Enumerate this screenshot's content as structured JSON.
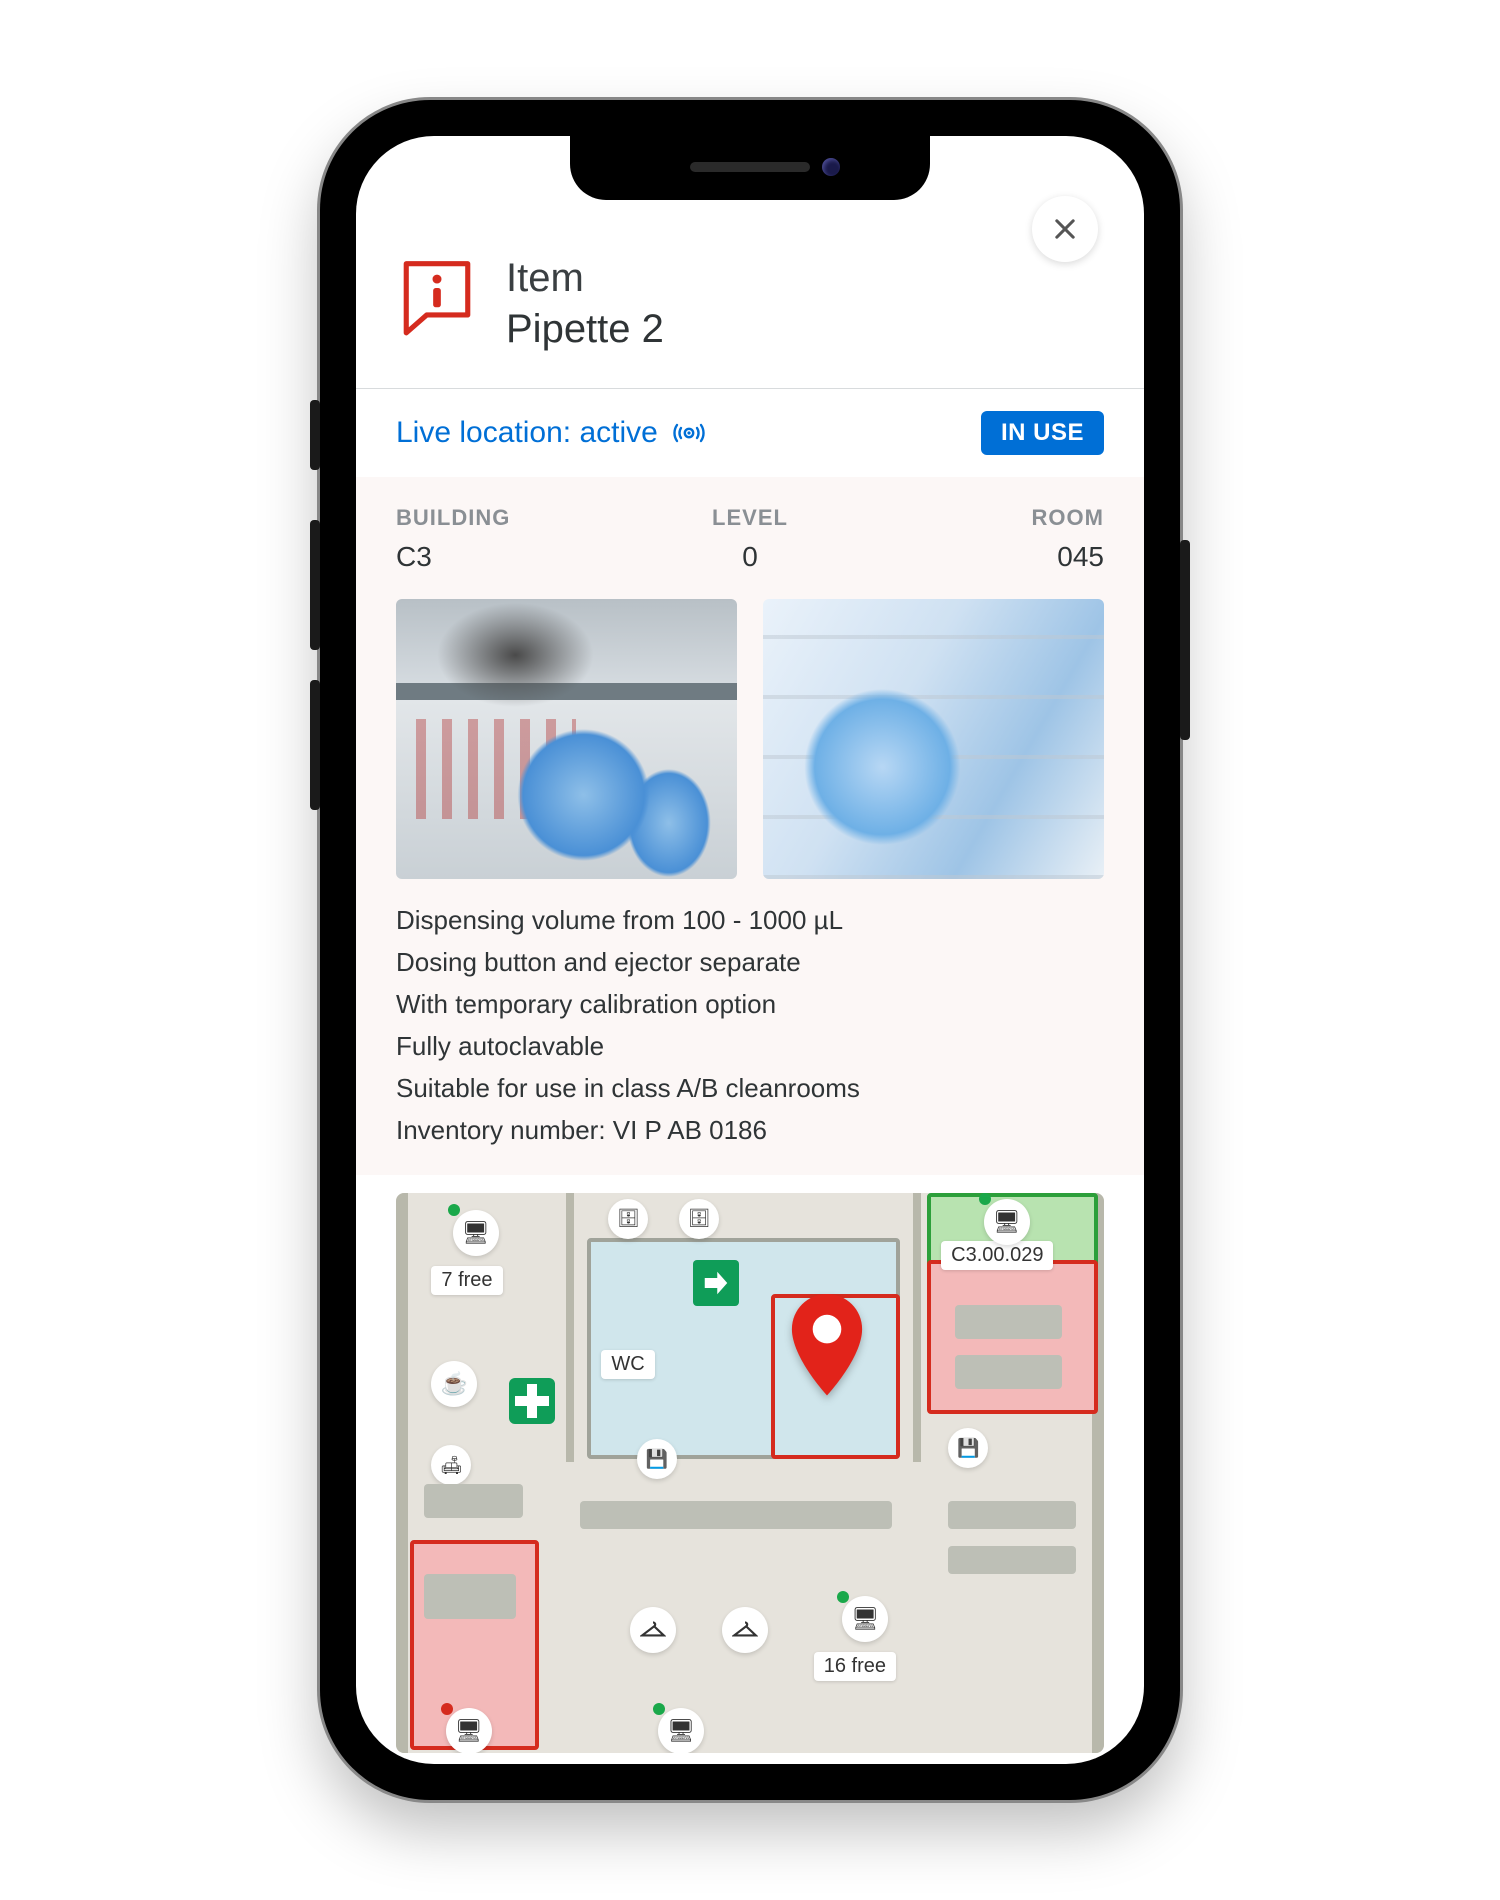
{
  "header": {
    "kicker": "Item",
    "title": "Pipette 2"
  },
  "live": {
    "label": "Live location: active",
    "status": "IN USE"
  },
  "meta": {
    "building_label": "BUILDING",
    "building_value": "C3",
    "level_label": "LEVEL",
    "level_value": "0",
    "room_label": "ROOM",
    "room_value": "045"
  },
  "description": [
    "Dispensing volume from 100 - 1000 µL",
    "Dosing button and ejector separate",
    "With temporary calibration option",
    "Fully autoclavable",
    "Suitable for use in class A/B cleanrooms",
    "Inventory number: VI P AB 0186"
  ],
  "map": {
    "room_label": "C3.00.029",
    "free_top": "7 free",
    "free_bottom": "16 free",
    "wc_label": "WC"
  },
  "icons": {
    "info": "info-speech-bubble",
    "signal": "live-signal"
  }
}
